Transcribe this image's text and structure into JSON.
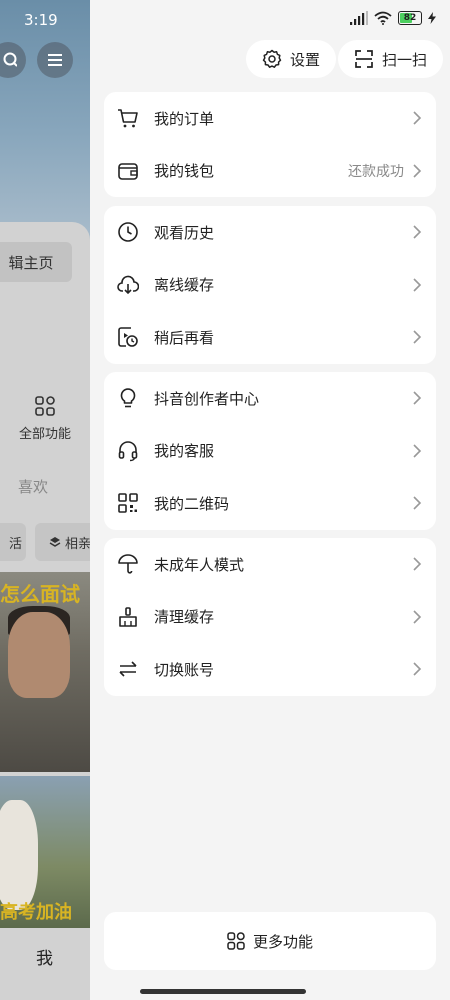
{
  "background": {
    "time": "3:19",
    "edit_profile": "辑主页",
    "all_functions": "全部功能",
    "likes_tab": "喜欢",
    "chip_1": "活",
    "chip_2": "相亲",
    "video_1_caption": "怎么面试",
    "video_2_caption": "高考加油",
    "nav_me": "我"
  },
  "status_bar": {
    "battery": "82"
  },
  "top_buttons": {
    "settings": "设置",
    "scan": "扫一扫"
  },
  "groups": [
    {
      "items": [
        {
          "label": "我的订单",
          "icon": "cart-icon"
        },
        {
          "label": "我的钱包",
          "icon": "wallet-icon",
          "extra": "还款成功"
        }
      ]
    },
    {
      "items": [
        {
          "label": "观看历史",
          "icon": "clock-icon"
        },
        {
          "label": "离线缓存",
          "icon": "cloud-download-icon"
        },
        {
          "label": "稍后再看",
          "icon": "watch-later-icon"
        }
      ]
    },
    {
      "items": [
        {
          "label": "抖音创作者中心",
          "icon": "lightbulb-icon"
        },
        {
          "label": "我的客服",
          "icon": "headset-icon"
        },
        {
          "label": "我的二维码",
          "icon": "qrcode-icon"
        }
      ]
    },
    {
      "items": [
        {
          "label": "未成年人模式",
          "icon": "umbrella-icon"
        },
        {
          "label": "清理缓存",
          "icon": "broom-icon"
        },
        {
          "label": "切换账号",
          "icon": "switch-icon"
        }
      ]
    }
  ],
  "more_functions": "更多功能",
  "colors": {
    "drawer_bg": "#f4f4f4",
    "card_bg": "#ffffff",
    "battery_green": "#4ccf5f",
    "caption_yellow": "#d8b423"
  }
}
